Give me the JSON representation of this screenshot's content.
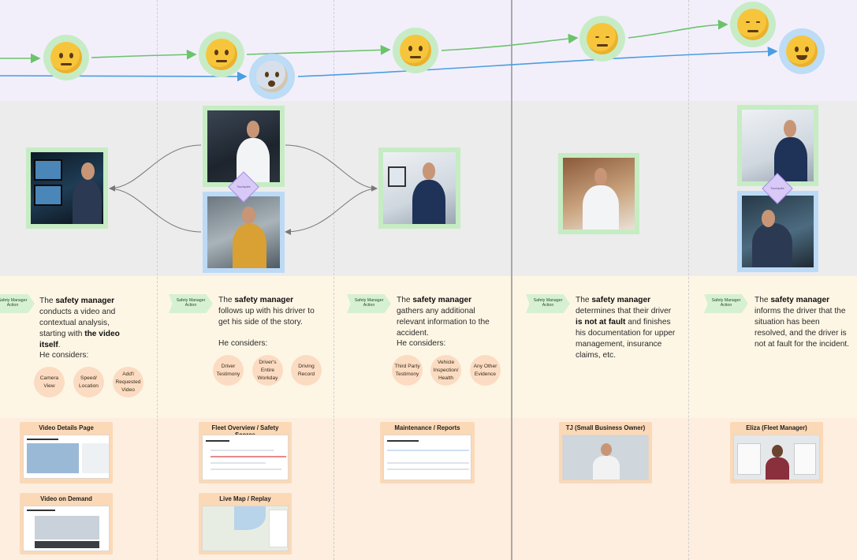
{
  "steps": [
    {
      "tag": "Safety Manager Action",
      "text_parts": [
        {
          "t": "The ",
          "b": false
        },
        {
          "t": "safety manager",
          "b": true
        },
        {
          "t": " conducts a video and contextual analysis, starting with ",
          "b": false
        },
        {
          "t": "the video itself",
          "b": true
        },
        {
          "t": ".",
          "b": false
        }
      ],
      "considers": "He considers:",
      "chips": [
        "Camera View",
        "Speed/ Location",
        "Add'l Requested Video"
      ]
    },
    {
      "tag": "Safety Manager Action",
      "text_parts": [
        {
          "t": "The ",
          "b": false
        },
        {
          "t": "safety manager",
          "b": true
        },
        {
          "t": " follows up with his driver to get his side of the story.",
          "b": false
        }
      ],
      "considers": "He considers:",
      "chips": [
        "Driver Testimony",
        "Driver's Entire Workday",
        "Driving Record"
      ]
    },
    {
      "tag": "Safety Manager Action",
      "text_parts": [
        {
          "t": "The ",
          "b": false
        },
        {
          "t": "safety manager",
          "b": true
        },
        {
          "t": " gathers any additional relevant information to the accident.",
          "b": false
        }
      ],
      "considers": "He considers:",
      "chips": [
        "Third Party Testimony",
        "Vehicle Inspection/ Health",
        "Any Other Evidence"
      ]
    },
    {
      "tag": "Safety Manager Action",
      "text_parts": [
        {
          "t": "The ",
          "b": false
        },
        {
          "t": "safety manager",
          "b": true
        },
        {
          "t": " determines that their driver ",
          "b": false
        },
        {
          "t": "is not at fault",
          "b": true
        },
        {
          "t": " and finishes his documentation for upper management, insurance claims, etc.",
          "b": false
        }
      ],
      "considers": "",
      "chips": []
    },
    {
      "tag": "Safety Manager Action",
      "text_parts": [
        {
          "t": "The ",
          "b": false
        },
        {
          "t": "safety manager",
          "b": true
        },
        {
          "t": " informs the driver that the situation has been resolved, and the driver is not at fault for the incident.",
          "b": false
        }
      ],
      "considers": "",
      "chips": []
    }
  ],
  "diamond_label": "Touchpoint",
  "emotions": [
    {
      "name": "thinking-emoji",
      "bg": "green",
      "mood": "thinking"
    },
    {
      "name": "raised-eyebrow-emoji",
      "bg": "green",
      "mood": "skeptical"
    },
    {
      "name": "fearful-emoji",
      "bg": "blue",
      "mood": "fear"
    },
    {
      "name": "thinking-emoji",
      "bg": "green",
      "mood": "thinking"
    },
    {
      "name": "sighing-emoji",
      "bg": "green",
      "mood": "tired"
    },
    {
      "name": "relieved-emoji",
      "bg": "green",
      "mood": "relief"
    },
    {
      "name": "melting-emoji",
      "bg": "blue",
      "mood": "smile"
    }
  ],
  "colors": {
    "emotion_band": "#f2effb",
    "image_band": "#ececec",
    "action_band": "#fef6e5",
    "screen_band": "#fdeedf",
    "manager_line": "#6cc36a",
    "driver_line": "#4b9ee0",
    "manager_frame": "#c6ecc3",
    "driver_frame": "#bcdaf5",
    "chip": "#fbdcc2",
    "tag": "#d6f1d2",
    "touchpoint": "#d8c9f7"
  },
  "screens": [
    {
      "title": "Video Details Page"
    },
    {
      "title": "Video on Demand"
    },
    {
      "title": "Fleet Overview / Safety Scores"
    },
    {
      "title": "Live Map / Replay"
    },
    {
      "title": "Maintenance / Reports"
    },
    {
      "title": "TJ (Small Business Owner)"
    },
    {
      "title": "Eliza (Fleet Manager)"
    }
  ]
}
